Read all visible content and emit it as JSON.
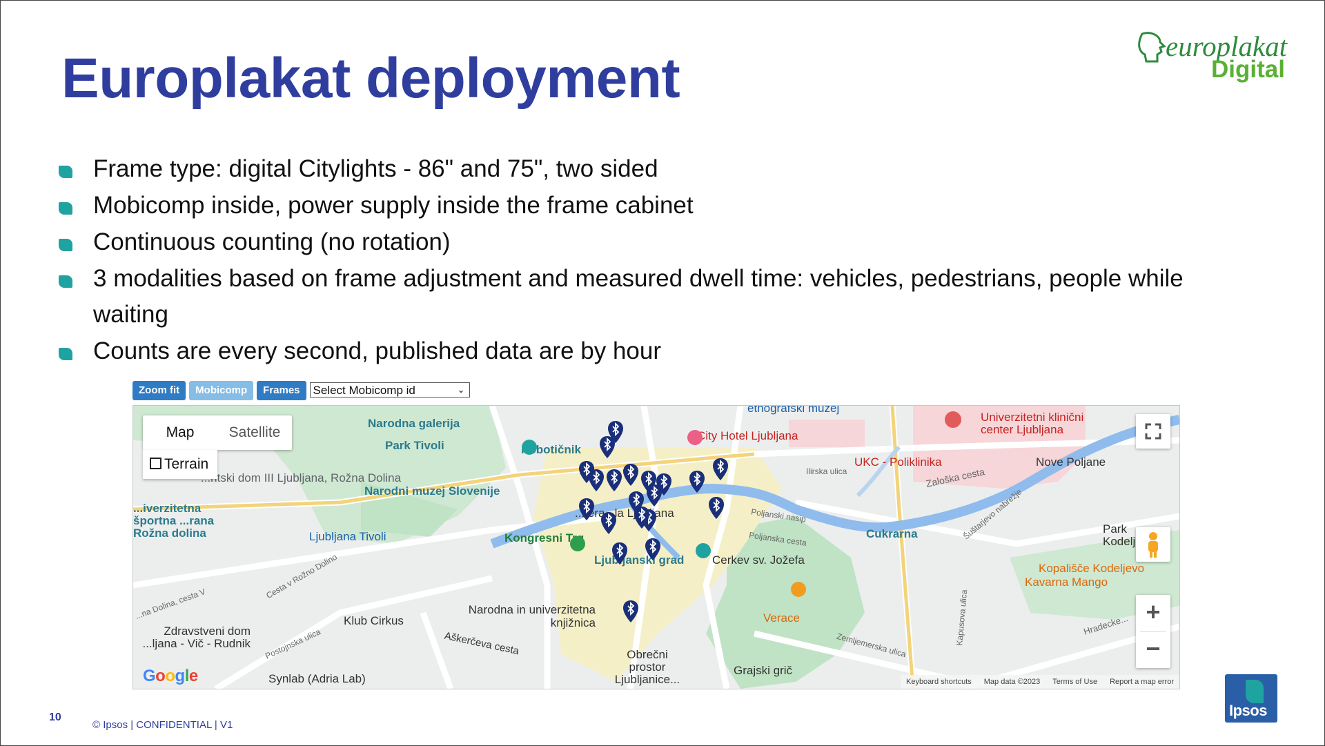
{
  "slide": {
    "title": "Europlakat deployment",
    "page_number": "10",
    "copyright": "©  Ipsos | CONFIDENTIAL | V1"
  },
  "logos": {
    "europlakat_word": "europlakat",
    "europlakat_digital": "Digital",
    "ipsos": "Ipsos"
  },
  "bullets": [
    "Frame type:  digital Citylights - 86\" and 75\", two sided",
    "Mobicomp inside, power supply inside the frame cabinet",
    "Continuous counting (no rotation)",
    "3 modalities based on frame adjustment and measured dwell time: vehicles, pedestrians, people while waiting",
    "Counts are every second, published data are by hour"
  ],
  "map_toolbar": {
    "zoom_fit": "Zoom fit",
    "mobicomp": "Mobicomp",
    "frames": "Frames",
    "select_placeholder": "Select Mobicomp id"
  },
  "map": {
    "map_type": "Map",
    "satellite": "Satellite",
    "terrain": "Terrain",
    "google": "Google",
    "attribution": {
      "shortcuts": "Keyboard shortcuts",
      "data": "Map data ©2023",
      "terms": "Terms of Use",
      "report": "Report a map error"
    },
    "labels": {
      "narodna_galerija": "Narodna galerija",
      "park_tivoli": "Park Tivoli",
      "neboticnik": "Nebotičnik",
      "city_hotel": "City Hotel Ljubljana",
      "etnografski": "etnografski muzej",
      "ukc_center": "Univerzitetni klinični center Ljubljana",
      "ukc_poliklinika": "UKC - Poliklinika",
      "ilirska": "Ilirska ulica",
      "nove_poljane": "Nove Poljane",
      "zaloska": "Zaloška cesta",
      "dom_iii": "...ntski dom III Ljubljana, Rožna Dolina",
      "muzej_slovenije": "Narodni muzej Slovenije",
      "sportna": "...iverzitetna športna ...rana Rožna dolina",
      "ljubljana_tivoli": "Ljubljana Tivoli",
      "kongresni_trg": "Kongresni Trg",
      "ljubljana_center": "...tera...la Ljubljana",
      "ljubljanski_grad": "Ljubljanski grad",
      "cerkev": "Cerkev sv. Jožefa",
      "cukrarna": "Cukrarna",
      "park_kodeljevo": "Park Kodeljevo",
      "kopalisce": "Kopališče Kodeljevo",
      "kavarna": "Kavarna Mango",
      "narodna_knjiznica": "Narodna in univerzitetna knjižnica",
      "klub_cirkus": "Klub Cirkus",
      "zdravstveni": "Zdravstveni dom ...ljana - Vič - Rudnik",
      "askerceva": "Aškerčeva cesta",
      "verace": "Verace",
      "obrecni": "Obrečni prostor Ljubljanice...",
      "grajski_gric": "Grajski grič",
      "synlab": "Synlab (Adria Lab)",
      "poljanska": "Poljanska cesta",
      "poljanski_nasip": "Poljanski nasip",
      "hradecke": "Hradecke...",
      "zemljemerska": "Zemljemerska ulica",
      "sustarjevo": "Šuštarjevo nabrežje",
      "postojnska": "Postojnska ulica",
      "cesta_rozna": "Cesta v Rožno Dolino",
      "rozna_dolina_v": "...na Dolina, cesta V",
      "kapusova": "Kapusova ulica"
    }
  },
  "colors": {
    "title": "#2f3e9e",
    "bullet_mark": "#1fa3a1",
    "toolbar_button": "#2f7cc4",
    "toolbar_button_inactive": "#86bde6",
    "bluetooth_pin": "#1a2f7a",
    "river": "#8fbcec",
    "park": "#bfe3c4"
  },
  "bluetooth_pin_icon": "bluetooth-icon"
}
